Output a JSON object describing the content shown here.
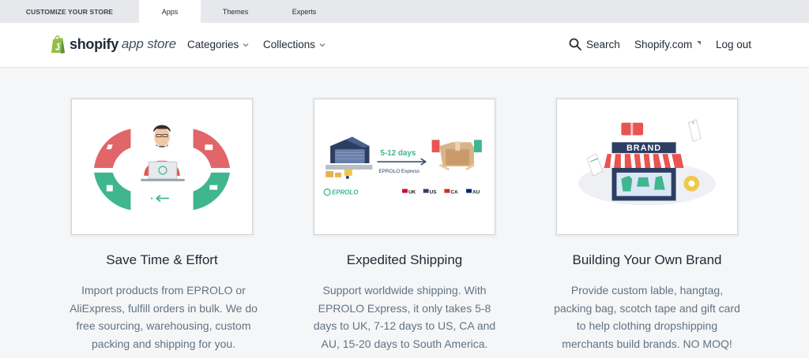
{
  "topbar": {
    "tabs": [
      {
        "label": "CUSTOMIZE YOUR STORE"
      },
      {
        "label": "Apps"
      },
      {
        "label": "Themes"
      },
      {
        "label": "Experts"
      }
    ]
  },
  "header": {
    "logo_brand": "shopify",
    "logo_sub": "app store",
    "nav": {
      "categories": "Categories",
      "collections": "Collections",
      "search": "Search",
      "shopify_com": "Shopify.com",
      "logout": "Log out"
    }
  },
  "features": [
    {
      "title": "Save Time & Effort",
      "description": "Import products from EPROLO or AliExpress, fulfill orders in bulk. We do free sourcing, warehousing, custom packing and shipping for you."
    },
    {
      "title": "Expedited Shipping",
      "description": "Support worldwide shipping. With EPROLO Express, it only takes 5-8 days to UK, 7-12 days to US, CA and AU, 15-20 days to South America."
    },
    {
      "title": "Building Your Own Brand",
      "description": "Provide custom lable, hangtag, packing bag, scotch tape and gift card to help clothing dropshipping merchants build brands. NO MOQ!"
    }
  ],
  "illustrations": {
    "shipping": {
      "days": "5-12 days",
      "service": "EPROLO Express",
      "logo": "EPROLO",
      "countries": [
        "UK",
        "US",
        "CA",
        "AU"
      ]
    },
    "brand": {
      "sign": "BRAND"
    }
  },
  "colors": {
    "accent_green": "#3fb68e",
    "accent_red": "#e0666a",
    "brand_dark": "#2d3e63"
  }
}
